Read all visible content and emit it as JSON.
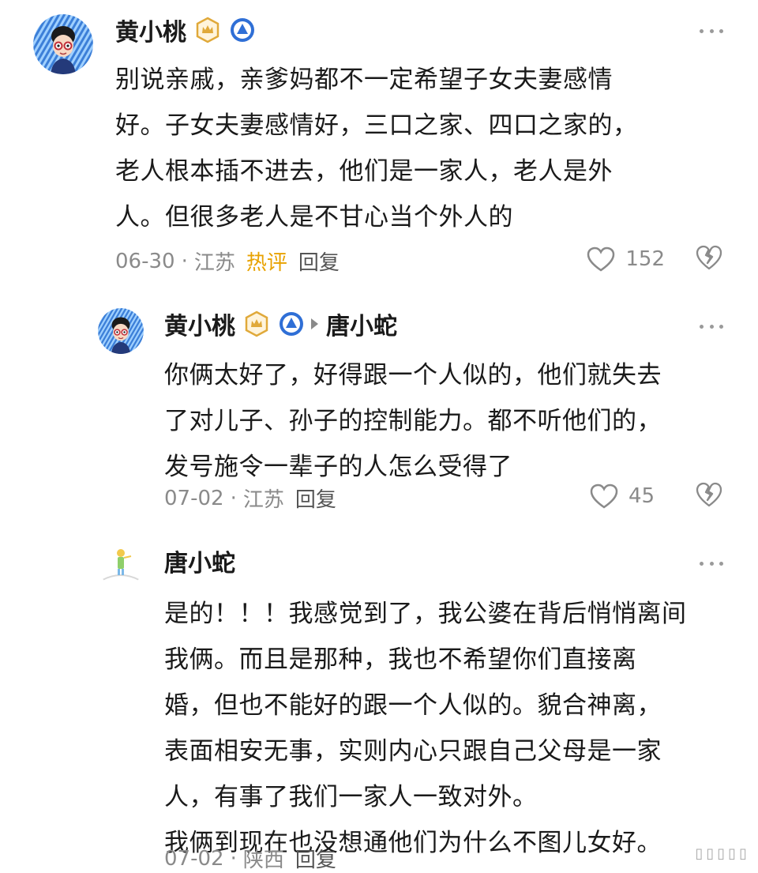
{
  "comments": [
    {
      "author": "黄小桃",
      "avatar_icon": "cartoon-avatar-icon",
      "badges": [
        "gold-crown-badge-icon",
        "blue-level-badge-icon"
      ],
      "body_lines": [
        "别说亲戚，亲爹妈都不一定希望子女夫妻感情",
        "好。子女夫妻感情好，三口之家、四口之家的，",
        "老人根本插不进去，他们是一家人，老人是外",
        "人。但很多老人是不甘心当个外人的"
      ],
      "date": "06-30",
      "location": "江苏",
      "tag": "热评",
      "reply_label": "回复",
      "likes": "152"
    },
    {
      "author": "黄小桃",
      "reply_to": "唐小蛇",
      "avatar_icon": "cartoon-avatar-icon",
      "badges": [
        "gold-crown-badge-icon",
        "blue-level-badge-icon"
      ],
      "body_lines": [
        "你俩太好了，好得跟一个人似的，他们就失去",
        "了对儿子、孙子的控制能力。都不听他们的，",
        "发号施令一辈子的人怎么受得了"
      ],
      "date": "07-02",
      "location": "江苏",
      "reply_label": "回复",
      "likes": "45"
    },
    {
      "author": "唐小蛇",
      "avatar_icon": "little-prince-avatar-icon",
      "body_lines": [
        "是的！！！我感觉到了，我公婆在背后悄悄离间",
        "我俩。而且是那种，我也不希望你们直接离",
        "婚，但也不能好的跟一个人似的。貌合神离，",
        "表面相安无事，实则内心只跟自己父母是一家",
        "人，有事了我们一家人一致对外。",
        "我俩到现在也没想通他们为什么不图儿女好。"
      ],
      "date": "07-02",
      "location": "陕西",
      "reply_label": "回复"
    }
  ],
  "colors": {
    "text": "#1a1a1a",
    "meta": "#8a8a8a",
    "hot_tag": "#e8a200",
    "badge_gold": "#e0a93a",
    "badge_blue": "#2f6fd6"
  }
}
